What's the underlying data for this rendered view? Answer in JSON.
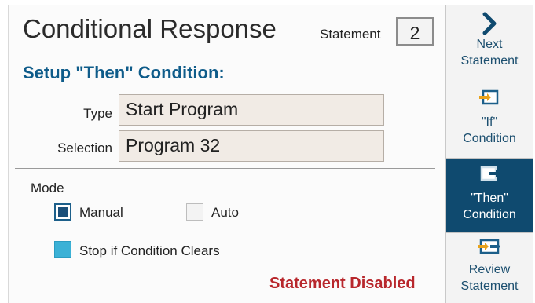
{
  "header": {
    "title": "Conditional Response",
    "statement_label": "Statement",
    "statement_value": "2"
  },
  "setup": {
    "heading": "Setup \"Then\" Condition:"
  },
  "fields": {
    "type": {
      "label": "Type",
      "value": "Start Program"
    },
    "selection": {
      "label": "Selection",
      "value": "Program 32"
    }
  },
  "mode": {
    "label": "Mode",
    "manual": {
      "label": "Manual",
      "checked": true
    },
    "auto": {
      "label": "Auto",
      "checked": false
    }
  },
  "stop_option": {
    "label": "Stop if Condition Clears"
  },
  "status": {
    "text": "Statement Disabled",
    "color": "#b8272c"
  },
  "sidebar": {
    "items": [
      {
        "line1": "Next",
        "line2": "Statement",
        "icon": "chevron-right-icon",
        "active": false
      },
      {
        "line1": "\"If\"",
        "line2": "Condition",
        "icon": "if-condition-icon",
        "active": false
      },
      {
        "line1": "\"Then\"",
        "line2": "Condition",
        "icon": "then-condition-icon",
        "active": true
      },
      {
        "line1": "Review",
        "line2": "Statement",
        "icon": "review-statement-icon",
        "active": false
      }
    ]
  },
  "colors": {
    "accent": "#0f5c8a",
    "active_sidebar": "#0f4a6f",
    "checkbox_cyan": "#3bb1d6"
  }
}
